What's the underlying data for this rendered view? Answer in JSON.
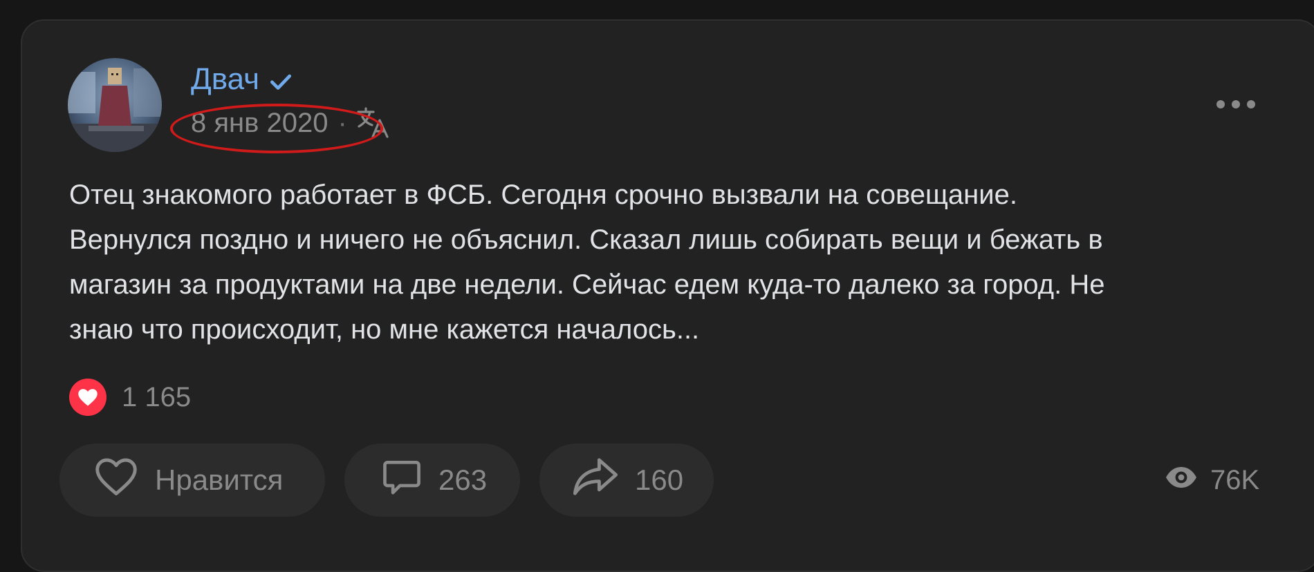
{
  "post": {
    "author": "Двач",
    "date": "8 янв 2020",
    "date_separator": "·",
    "text_lines": [
      "Отец знакомого работает в ФСБ. Сегодня срочно вызвали на совещание.",
      "Вернулся поздно и ничего не объяснил. Сказал лишь собирать вещи и бежать в",
      "магазин за продуктами на две недели. Сейчас едем куда-то далеко за город. Не",
      "знаю что происходит, но мне кажется началось..."
    ],
    "reaction_count": "1 165",
    "actions": {
      "like_label": "Нравится",
      "comments_count": "263",
      "shares_count": "160"
    },
    "views_count": "76K"
  },
  "icons": {
    "verified": "verified-check-icon",
    "translate": "translate-icon",
    "more": "more-dots-icon",
    "reaction": "heart-icon",
    "like": "heart-outline-icon",
    "comment": "comment-icon",
    "share": "share-icon",
    "views": "eye-icon"
  },
  "colors": {
    "background": "#161616",
    "card": "#222222",
    "author_link": "#71aaeb",
    "text": "#e1e3e6",
    "secondary": "#8a8a8a",
    "reaction": "#ff3347",
    "annotation": "#d11a1a"
  }
}
